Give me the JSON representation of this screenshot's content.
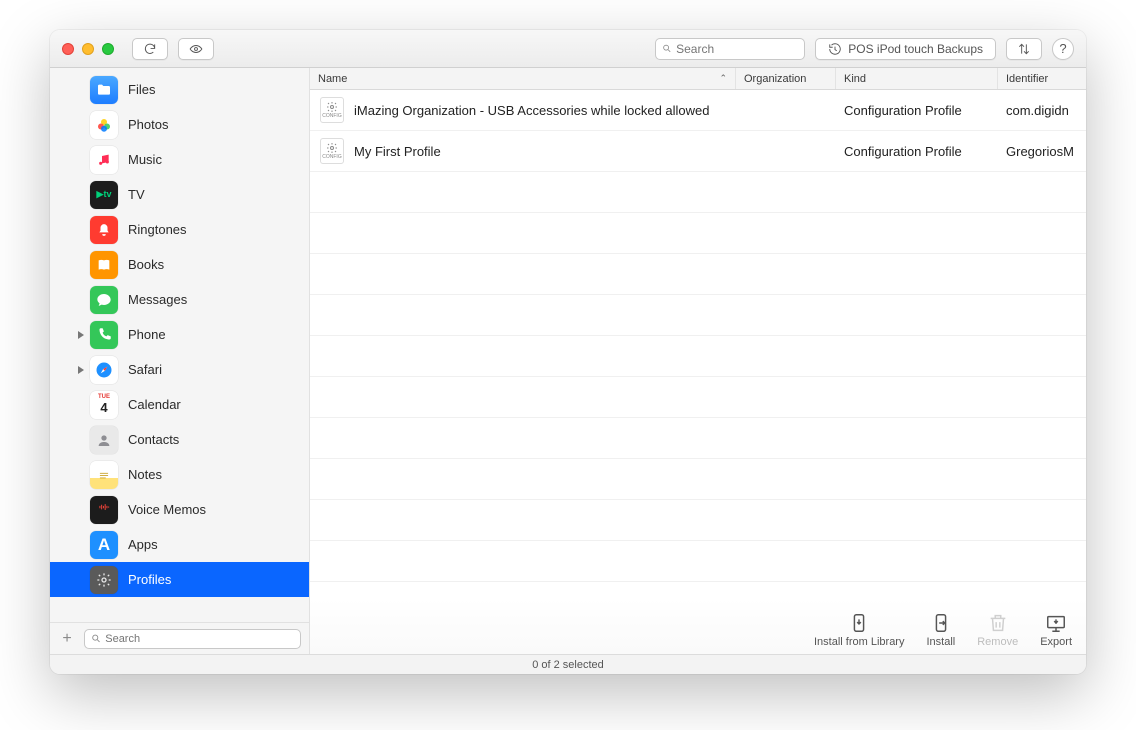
{
  "titlebar": {
    "search_placeholder": "Search",
    "history_label": "POS iPod touch Backups",
    "help_label": "?"
  },
  "sidebar": {
    "items": [
      {
        "label": "Files",
        "icon": "files-icon",
        "disclosure": false
      },
      {
        "label": "Photos",
        "icon": "photos-icon",
        "disclosure": false
      },
      {
        "label": "Music",
        "icon": "music-icon",
        "disclosure": false
      },
      {
        "label": "TV",
        "icon": "tv-icon",
        "disclosure": false
      },
      {
        "label": "Ringtones",
        "icon": "ringtones-icon",
        "disclosure": false
      },
      {
        "label": "Books",
        "icon": "books-icon",
        "disclosure": false
      },
      {
        "label": "Messages",
        "icon": "messages-icon",
        "disclosure": false
      },
      {
        "label": "Phone",
        "icon": "phone-icon",
        "disclosure": true
      },
      {
        "label": "Safari",
        "icon": "safari-icon",
        "disclosure": true
      },
      {
        "label": "Calendar",
        "icon": "calendar-icon",
        "disclosure": false
      },
      {
        "label": "Contacts",
        "icon": "contacts-icon",
        "disclosure": false
      },
      {
        "label": "Notes",
        "icon": "notes-icon",
        "disclosure": false
      },
      {
        "label": "Voice Memos",
        "icon": "voice-memos-icon",
        "disclosure": false
      },
      {
        "label": "Apps",
        "icon": "apps-icon",
        "disclosure": false
      },
      {
        "label": "Profiles",
        "icon": "profiles-icon",
        "disclosure": false,
        "selected": true
      }
    ],
    "search_placeholder": "Search"
  },
  "table": {
    "columns": {
      "name": "Name",
      "organization": "Organization",
      "kind": "Kind",
      "identifier": "Identifier"
    },
    "rows": [
      {
        "name": "iMazing Organization - USB Accessories while locked allowed",
        "organization": "",
        "kind": "Configuration Profile",
        "identifier": "com.digidn"
      },
      {
        "name": "My First Profile",
        "organization": "",
        "kind": "Configuration Profile",
        "identifier": "GregoriosM"
      }
    ]
  },
  "actions": {
    "install_library": "Install from Library",
    "install": "Install",
    "remove": "Remove",
    "export": "Export"
  },
  "statusbar": "0 of 2 selected"
}
